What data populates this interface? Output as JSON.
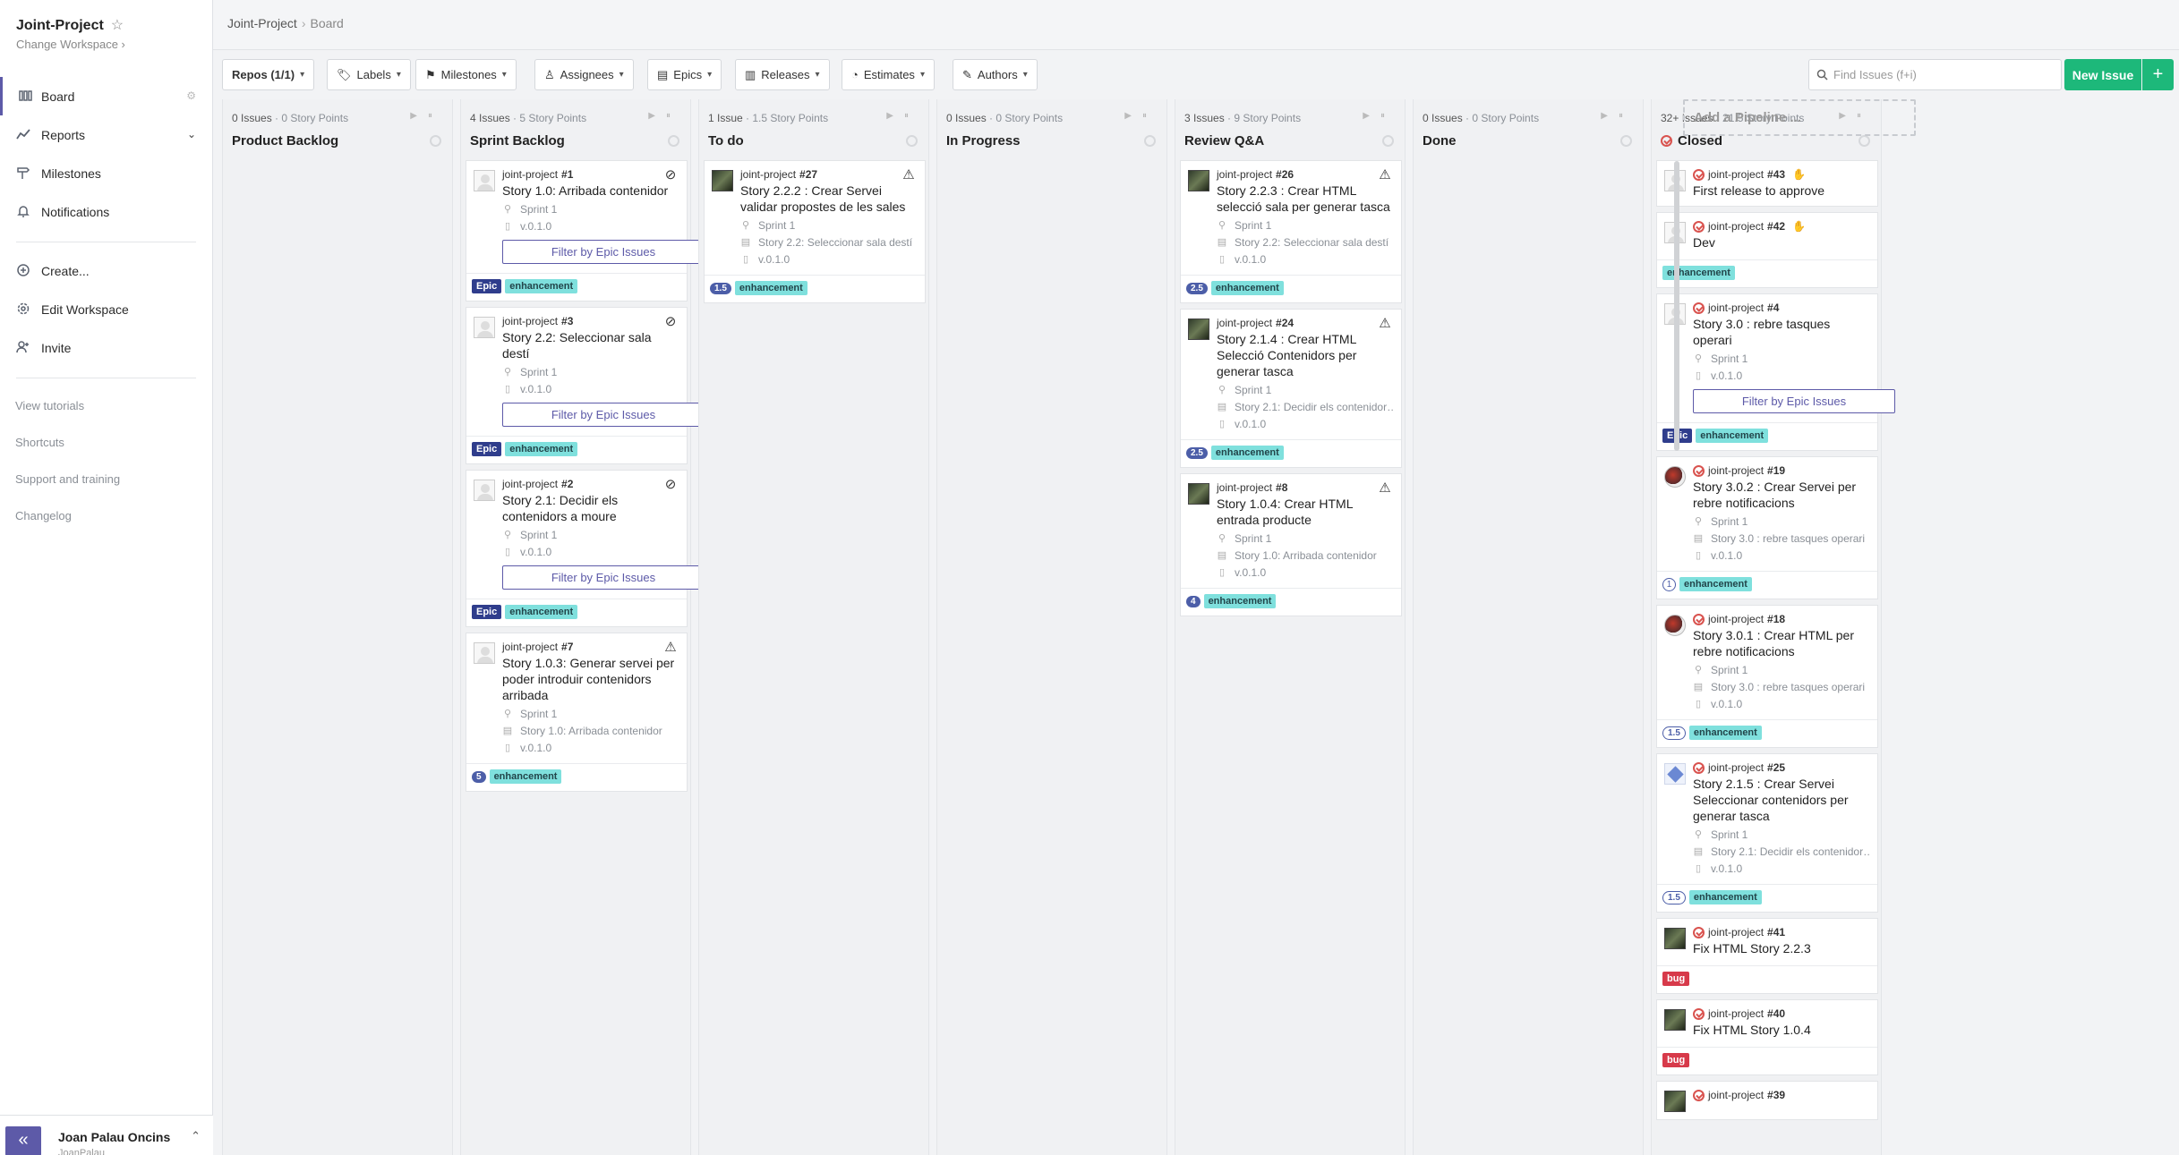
{
  "sidebar": {
    "workspace": "Joint-Project",
    "change_workspace": "Change Workspace",
    "nav": [
      {
        "label": "Board"
      },
      {
        "label": "Reports"
      },
      {
        "label": "Milestones"
      },
      {
        "label": "Notifications"
      },
      {
        "label": "Create..."
      },
      {
        "label": "Edit Workspace"
      },
      {
        "label": "Invite"
      }
    ],
    "links": [
      "View tutorials",
      "Shortcuts",
      "Support and training",
      "Changelog"
    ],
    "user_name": "Joan Palau Oncins",
    "user_handle": "JoanPalau"
  },
  "header": {
    "crumb_root": "Joint-Project",
    "crumb_current": "Board"
  },
  "toolbar": {
    "repos": "Repos (1/1)",
    "labels": "Labels",
    "milestones": "Milestones",
    "assignees": "Assignees",
    "epics": "Epics",
    "releases": "Releases",
    "estimates": "Estimates",
    "authors": "Authors",
    "search_placeholder": "Find Issues (f+i)",
    "new_issue": "New Issue",
    "new_plus": "+"
  },
  "add_pipeline": "Add a Pipeline ...",
  "filter_by_epic": "Filter by Epic Issues",
  "pipelines": [
    {
      "count": "0 Issues",
      "points": " · 0 Story Points",
      "name": "Product Backlog",
      "cards": []
    },
    {
      "count": "4 Issues",
      "points": " · 5 Story Points",
      "name": "Sprint Backlog",
      "cards": [
        {
          "repo": "joint-project",
          "num": "#1",
          "title": "Story 1.0: Arribada contenidor",
          "avatar": "default",
          "corner": "⊘",
          "attrs": [
            {
              "icon": "milestone",
              "text": "Sprint 1"
            },
            {
              "icon": "release",
              "text": "v.0.1.0"
            }
          ],
          "epic_btn": true,
          "labels": [
            {
              "t": "Epic",
              "k": "epic"
            },
            {
              "t": "enhancement",
              "k": "enh"
            }
          ]
        },
        {
          "repo": "joint-project",
          "num": "#3",
          "title": "Story 2.2: Seleccionar sala destí",
          "avatar": "default",
          "corner": "⊘",
          "attrs": [
            {
              "icon": "milestone",
              "text": "Sprint 1"
            },
            {
              "icon": "release",
              "text": "v.0.1.0"
            }
          ],
          "epic_btn": true,
          "labels": [
            {
              "t": "Epic",
              "k": "epic"
            },
            {
              "t": "enhancement",
              "k": "enh"
            }
          ]
        },
        {
          "repo": "joint-project",
          "num": "#2",
          "title": "Story 2.1: Decidir els contenidors a moure",
          "avatar": "default",
          "corner": "⊘",
          "attrs": [
            {
              "icon": "milestone",
              "text": "Sprint 1"
            },
            {
              "icon": "release",
              "text": "v.0.1.0"
            }
          ],
          "epic_btn": true,
          "labels": [
            {
              "t": "Epic",
              "k": "epic"
            },
            {
              "t": "enhancement",
              "k": "enh"
            }
          ]
        },
        {
          "repo": "joint-project",
          "num": "#7",
          "title": "Story 1.0.3: Generar servei per poder introduir contenidors arribada",
          "avatar": "default",
          "corner": "⚠",
          "attrs": [
            {
              "icon": "milestone",
              "text": "Sprint 1"
            },
            {
              "icon": "epic",
              "text": "Story 1.0: Arribada contenidor"
            },
            {
              "icon": "release",
              "text": "v.0.1.0"
            }
          ],
          "epic_btn": false,
          "estimate": "5",
          "estimate_style": "solid",
          "labels": [
            {
              "t": "enhancement",
              "k": "enh"
            }
          ]
        }
      ]
    },
    {
      "count": "1 Issue",
      "points": " · 1.5 Story Points",
      "name": "To do",
      "cards": [
        {
          "repo": "joint-project",
          "num": "#27",
          "title": "Story 2.2.2 : Crear Servei validar propostes de les sales",
          "avatar": "photo",
          "corner": "⚠",
          "attrs": [
            {
              "icon": "milestone",
              "text": "Sprint 1"
            },
            {
              "icon": "epic",
              "text": "Story 2.2: Seleccionar sala destí"
            },
            {
              "icon": "release",
              "text": "v.0.1.0"
            }
          ],
          "epic_btn": false,
          "estimate": "1.5",
          "estimate_style": "solid",
          "labels": [
            {
              "t": "enhancement",
              "k": "enh"
            }
          ]
        }
      ]
    },
    {
      "count": "0 Issues",
      "points": " · 0 Story Points",
      "name": "In Progress",
      "cards": []
    },
    {
      "count": "3 Issues",
      "points": " · 9 Story Points",
      "name": "Review Q&A",
      "cards": [
        {
          "repo": "joint-project",
          "num": "#26",
          "title": "Story 2.2.3 : Crear HTML selecció sala per generar tasca",
          "avatar": "photo",
          "corner": "⚠",
          "attrs": [
            {
              "icon": "milestone",
              "text": "Sprint 1"
            },
            {
              "icon": "epic",
              "text": "Story 2.2: Seleccionar sala destí"
            },
            {
              "icon": "release",
              "text": "v.0.1.0"
            }
          ],
          "epic_btn": false,
          "estimate": "2.5",
          "estimate_style": "solid",
          "labels": [
            {
              "t": "enhancement",
              "k": "enh"
            }
          ]
        },
        {
          "repo": "joint-project",
          "num": "#24",
          "title": "Story 2.1.4 : Crear HTML Selecció Contenidors per generar tasca",
          "avatar": "photo",
          "corner": "⚠",
          "attrs": [
            {
              "icon": "milestone",
              "text": "Sprint 1"
            },
            {
              "icon": "epic",
              "text": "Story 2.1: Decidir els contenidor…"
            },
            {
              "icon": "release",
              "text": "v.0.1.0"
            }
          ],
          "epic_btn": false,
          "estimate": "2.5",
          "estimate_style": "solid",
          "labels": [
            {
              "t": "enhancement",
              "k": "enh"
            }
          ]
        },
        {
          "repo": "joint-project",
          "num": "#8",
          "title": "Story 1.0.4: Crear HTML entrada producte",
          "avatar": "photo",
          "corner": "⚠",
          "attrs": [
            {
              "icon": "milestone",
              "text": "Sprint 1"
            },
            {
              "icon": "epic",
              "text": "Story 1.0: Arribada contenidor"
            },
            {
              "icon": "release",
              "text": "v.0.1.0"
            }
          ],
          "epic_btn": false,
          "estimate": "4",
          "estimate_style": "solid",
          "labels": [
            {
              "t": "enhancement",
              "k": "enh"
            }
          ]
        }
      ]
    },
    {
      "count": "0 Issues",
      "points": " · 0 Story Points",
      "name": "Done",
      "cards": []
    },
    {
      "count": "32+ Issues",
      "points": " · 21.5 Story Points",
      "name": "Closed",
      "closed": true,
      "cards": [
        {
          "repo": "joint-project",
          "num": "#43",
          "title": "First release to approve",
          "avatar": "default",
          "closed": true,
          "hand": true,
          "attrs": [],
          "epic_btn": false,
          "labels": []
        },
        {
          "repo": "joint-project",
          "num": "#42",
          "title": "Dev",
          "avatar": "default",
          "closed": true,
          "hand": true,
          "attrs": [],
          "epic_btn": false,
          "labels": [
            {
              "t": "enhancement",
              "k": "enh"
            }
          ]
        },
        {
          "repo": "joint-project",
          "num": "#4",
          "title": "Story 3.0 : rebre tasques operari",
          "avatar": "default",
          "closed": true,
          "attrs": [
            {
              "icon": "milestone",
              "text": "Sprint 1"
            },
            {
              "icon": "release",
              "text": "v.0.1.0"
            }
          ],
          "epic_btn": true,
          "labels": [
            {
              "t": "Epic",
              "k": "epic"
            },
            {
              "t": "enhancement",
              "k": "enh"
            }
          ]
        },
        {
          "repo": "joint-project",
          "num": "#19",
          "title": "Story 3.0.2 : Crear Servei per rebre notificacions",
          "avatar": "round",
          "closed": true,
          "attrs": [
            {
              "icon": "milestone",
              "text": "Sprint 1"
            },
            {
              "icon": "epic",
              "text": "Story 3.0 : rebre tasques operari"
            },
            {
              "icon": "release",
              "text": "v.0.1.0"
            }
          ],
          "epic_btn": false,
          "estimate": "1",
          "estimate_style": "round",
          "labels": [
            {
              "t": "enhancement",
              "k": "enh"
            }
          ]
        },
        {
          "repo": "joint-project",
          "num": "#18",
          "title": "Story 3.0.1 : Crear HTML per rebre notificacions",
          "avatar": "round",
          "closed": true,
          "attrs": [
            {
              "icon": "milestone",
              "text": "Sprint 1"
            },
            {
              "icon": "epic",
              "text": "Story 3.0 : rebre tasques operari"
            },
            {
              "icon": "release",
              "text": "v.0.1.0"
            }
          ],
          "epic_btn": false,
          "estimate": "1.5",
          "estimate_style": "pill",
          "labels": [
            {
              "t": "enhancement",
              "k": "enh"
            }
          ]
        },
        {
          "repo": "joint-project",
          "num": "#25",
          "title": "Story 2.1.5 : Crear Servei Seleccionar contenidors per generar tasca",
          "avatar": "blue",
          "closed": true,
          "attrs": [
            {
              "icon": "milestone",
              "text": "Sprint 1"
            },
            {
              "icon": "epic",
              "text": "Story 2.1: Decidir els contenidor…"
            },
            {
              "icon": "release",
              "text": "v.0.1.0"
            }
          ],
          "epic_btn": false,
          "estimate": "1.5",
          "estimate_style": "pill",
          "labels": [
            {
              "t": "enhancement",
              "k": "enh"
            }
          ]
        },
        {
          "repo": "joint-project",
          "num": "#41",
          "title": "Fix HTML Story 2.2.3",
          "avatar": "photo",
          "closed": true,
          "attrs": [],
          "epic_btn": false,
          "labels": [
            {
              "t": "bug",
              "k": "bug"
            }
          ]
        },
        {
          "repo": "joint-project",
          "num": "#40",
          "title": "Fix HTML Story 1.0.4",
          "avatar": "photo",
          "closed": true,
          "attrs": [],
          "epic_btn": false,
          "labels": [
            {
              "t": "bug",
              "k": "bug"
            }
          ]
        },
        {
          "repo": "joint-project",
          "num": "#39",
          "title": "",
          "avatar": "photo",
          "closed": true,
          "attrs": [],
          "epic_btn": false,
          "labels": []
        }
      ]
    }
  ]
}
